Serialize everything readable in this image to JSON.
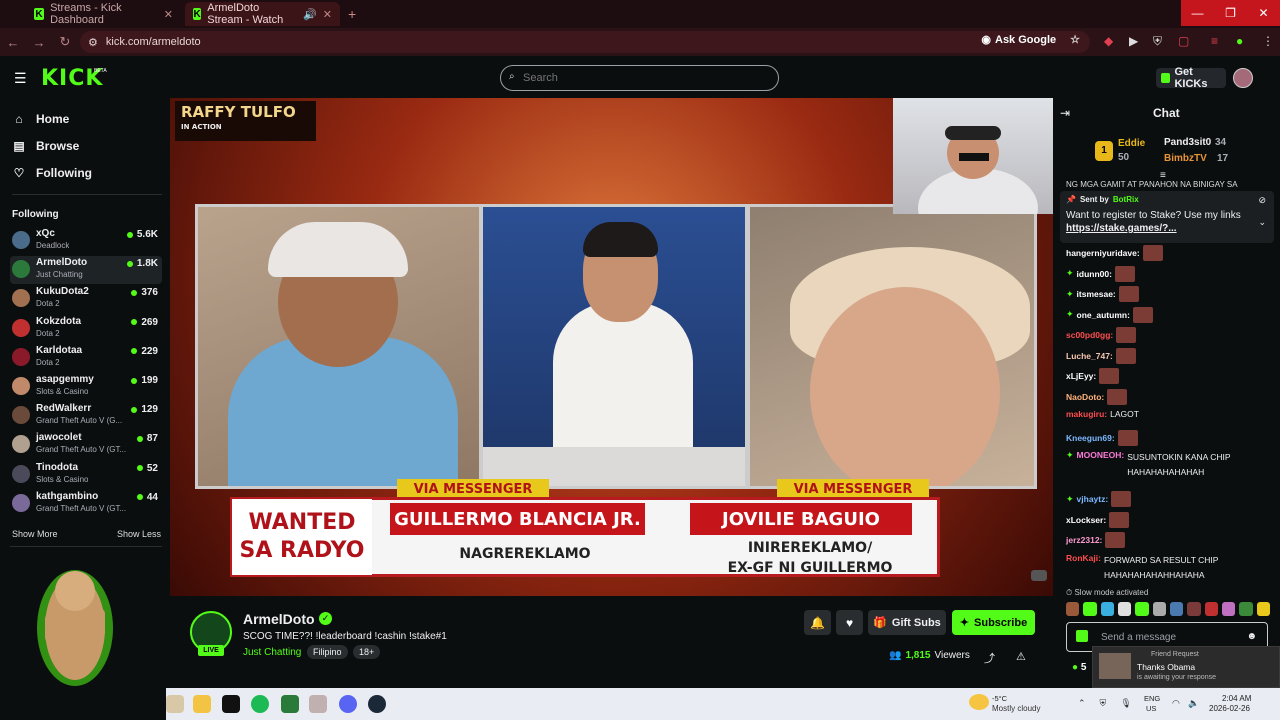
{
  "browser": {
    "tabs": [
      {
        "label": "Streams - Kick Dashboard"
      },
      {
        "label": "ArmelDoto Stream - Watch"
      }
    ],
    "url": "kick.com/armeldoto",
    "ask_google": "Ask Google",
    "window_controls": {
      "minimize": "—",
      "restore": "❐",
      "close": "✕"
    }
  },
  "header": {
    "logo": "KICK",
    "logo_badge": "BETA",
    "search_placeholder": "Search",
    "get_kicks": "Get KICKs"
  },
  "sidebar": {
    "nav": [
      {
        "label": "Home",
        "icon": "home-icon"
      },
      {
        "label": "Browse",
        "icon": "browse-icon"
      },
      {
        "label": "Following",
        "icon": "heart-icon"
      }
    ],
    "following_heading": "Following",
    "channels": [
      {
        "name": "xQc",
        "category": "Deadlock",
        "viewers": "5.6K",
        "color": "#4a6b8a"
      },
      {
        "name": "ArmelDoto",
        "category": "Just Chatting",
        "viewers": "1.8K",
        "color": "#2b7a3b"
      },
      {
        "name": "KukuDota2",
        "category": "Dota 2",
        "viewers": "376",
        "color": "#a07050"
      },
      {
        "name": "Kokzdota",
        "category": "Dota 2",
        "viewers": "269",
        "color": "#c03030"
      },
      {
        "name": "Karldotaa",
        "category": "Dota 2",
        "viewers": "229",
        "color": "#8a1a2a"
      },
      {
        "name": "asapgemmy",
        "category": "Slots & Casino",
        "viewers": "199",
        "color": "#c08a6a"
      },
      {
        "name": "RedWalkerr",
        "category": "Grand Theft Auto V (G...",
        "viewers": "129",
        "color": "#6a4a3a"
      },
      {
        "name": "jawocolet",
        "category": "Grand Theft Auto V (GT...",
        "viewers": "87",
        "color": "#b0a090"
      },
      {
        "name": "Tinodota",
        "category": "Slots & Casino",
        "viewers": "52",
        "color": "#4a4a5a"
      },
      {
        "name": "kathgambino",
        "category": "Grand Theft Auto V (GT...",
        "viewers": "44",
        "color": "#7a6a9a"
      }
    ],
    "show_more": "Show More",
    "show_less": "Show Less"
  },
  "video": {
    "show_logo_line1": "RAFFY TULFO",
    "show_logo_line2": "IN ACTION",
    "via_left": "VIA MESSENGER",
    "via_right": "VIA MESSENGER",
    "wanted": "WANTED SA RADYO",
    "name_left": "GUILLERMO BLANCIA JR.",
    "role_left": "NAGREREKLAMO",
    "name_right": "JOVILIE BAGUIO",
    "role_right_1": "INIREREKLAMO/",
    "role_right_2": "EX-GF NI GUILLERMO"
  },
  "stream": {
    "name": "ArmelDoto",
    "live": "LIVE",
    "title": "SCOG TIME??! !leaderboard !cashin !stake#1",
    "category": "Just Chatting",
    "tags": [
      "Filipino",
      "18+"
    ],
    "gift_subs": "Gift Subs",
    "subscribe": "Subscribe",
    "viewers_count": "1,815",
    "viewers_label": "Viewers"
  },
  "chat": {
    "title": "Chat",
    "leaderboard": [
      {
        "rank": "1",
        "name": "Eddie",
        "count": "50"
      },
      {
        "name": "Pand3sit0",
        "count": "34"
      },
      {
        "name": "BimbzTV",
        "count": "17"
      }
    ],
    "partial_line": "NG MGA GAMIT AT PANAHON NA BINIGAY SA",
    "pinned": {
      "sent_by": "Sent by",
      "bot": "BotRix",
      "message": "Want to register to Stake? Use my links",
      "link": "https://stake.games/?..."
    },
    "messages": [
      {
        "user": "hangerniyuridave:",
        "color": "#ffffff",
        "text": "",
        "emote": true,
        "badge": false
      },
      {
        "user": "idunn00:",
        "color": "#ffffff",
        "text": "",
        "emote": true,
        "badge": true
      },
      {
        "user": "itsmesae:",
        "color": "#ffffff",
        "text": "",
        "emote": true,
        "badge": true
      },
      {
        "user": "one_autumn:",
        "color": "#ffffff",
        "text": "",
        "emote": true,
        "badge": true
      },
      {
        "user": "sc00pd0gg:",
        "color": "#ff4d4d",
        "text": "",
        "emote": true,
        "badge": false
      },
      {
        "user": "Luche_747:",
        "color": "#f5c6b0",
        "text": "",
        "emote": true,
        "badge": false
      },
      {
        "user": "xLjEyy:",
        "color": "#ffffff",
        "text": "",
        "emote": true,
        "badge": false
      },
      {
        "user": "NaoDoto:",
        "color": "#ffb37a",
        "text": "",
        "emote": true,
        "badge": false
      },
      {
        "user": "makugiru:",
        "color": "#ff4d4d",
        "text": "LAGOT",
        "emote": false,
        "badge": false
      },
      {
        "user": "Kneegun69:",
        "color": "#7ab8ff",
        "text": "",
        "emote": true,
        "badge": false
      },
      {
        "user": "MOONEOH:",
        "color": "#ff7ad9",
        "text": "SUSUNTOKIN KANA CHIP HAHAHAHAHAHAH",
        "emote": false,
        "badge": true
      },
      {
        "user": "vjhaytz:",
        "color": "#7ab8ff",
        "text": "",
        "emote": true,
        "badge": true
      },
      {
        "user": "xLockser:",
        "color": "#ffffff",
        "text": "",
        "emote": true,
        "badge": false
      },
      {
        "user": "jerz2312:",
        "color": "#ff9ad0",
        "text": "",
        "emote": true,
        "badge": false
      },
      {
        "user": "RonKaji:",
        "color": "#ff4d4d",
        "text": "FORWARD SA RESULT CHIP HAHAHAHAHAHHAHAHA",
        "emote": false,
        "badge": false
      }
    ],
    "slow_mode": "Slow mode activated",
    "input_placeholder": "Send a message",
    "kicks_count": "5"
  },
  "notification": {
    "type": "Friend Request",
    "title": "Thanks Obama",
    "subtitle": "is awaiting your response"
  },
  "taskbar": {
    "weather_temp": "-5°C",
    "weather_desc": "Mostly cloudy",
    "lang1": "ENG",
    "lang2": "US",
    "time": "2:04 AM",
    "date": "2026-02-26"
  },
  "colors": {
    "accent": "#53fc18",
    "browser_frame": "#2b1216",
    "close_button": "#c4161c"
  }
}
